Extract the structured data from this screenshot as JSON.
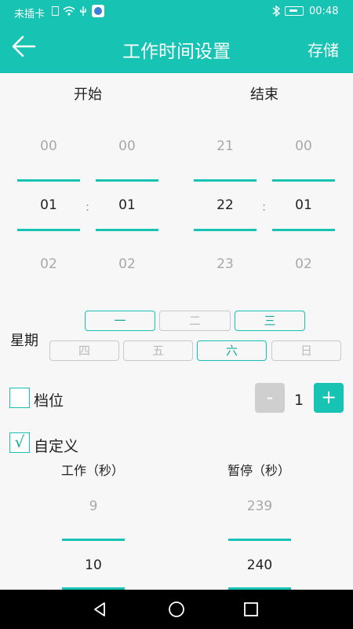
{
  "status_bar": {
    "carrier": "未插卡",
    "time": "00:48"
  },
  "header": {
    "title": "工作时间设置",
    "save_label": "存储"
  },
  "time_picker": {
    "start": {
      "label": "开始",
      "hour": {
        "prev": "00",
        "value": "01",
        "next": "02"
      },
      "minute": {
        "prev": "00",
        "value": "01",
        "next": "02"
      }
    },
    "end": {
      "label": "结束",
      "hour": {
        "prev": "21",
        "value": "22",
        "next": "23"
      },
      "minute": {
        "prev": "00",
        "value": "01",
        "next": "02"
      }
    },
    "separator": ":"
  },
  "weekdays": {
    "label": "星期",
    "days": [
      {
        "label": "一",
        "selected": true
      },
      {
        "label": "二",
        "selected": false
      },
      {
        "label": "三",
        "selected": true
      },
      {
        "label": "四",
        "selected": false
      },
      {
        "label": "五",
        "selected": false
      },
      {
        "label": "六",
        "selected": true
      },
      {
        "label": "日",
        "selected": false
      }
    ]
  },
  "gear": {
    "label": "档位",
    "checked": false,
    "value": "1",
    "minus": "-",
    "plus": "+"
  },
  "custom": {
    "label": "自定义",
    "checked": true,
    "check_mark": "√",
    "work": {
      "label": "工作（秒）",
      "prev": "9",
      "value": "10"
    },
    "pause": {
      "label": "暂停（秒）",
      "prev": "239",
      "value": "240"
    }
  },
  "colors": {
    "accent": "#17c3b2",
    "disabled": "#cfcfcf"
  }
}
